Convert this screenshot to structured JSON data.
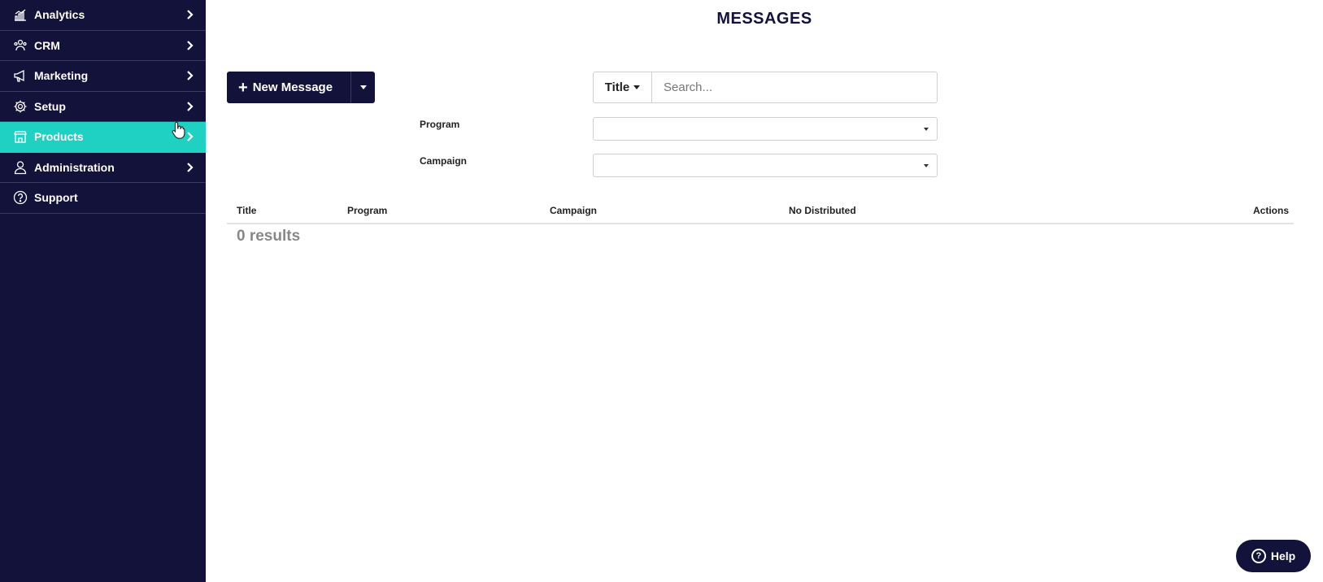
{
  "sidebar": {
    "items": [
      {
        "label": "Analytics",
        "icon": "analytics-icon",
        "has_chevron": true
      },
      {
        "label": "CRM",
        "icon": "crm-icon",
        "has_chevron": true
      },
      {
        "label": "Marketing",
        "icon": "megaphone-icon",
        "has_chevron": true
      },
      {
        "label": "Setup",
        "icon": "gear-icon",
        "has_chevron": true
      },
      {
        "label": "Products",
        "icon": "store-icon",
        "has_chevron": true,
        "active": true
      },
      {
        "label": "Administration",
        "icon": "user-icon",
        "has_chevron": true
      },
      {
        "label": "Support",
        "icon": "question-icon",
        "has_chevron": false
      }
    ]
  },
  "page": {
    "title": "MESSAGES"
  },
  "toolbar": {
    "new_button_label": "New Message"
  },
  "search": {
    "field_selector": "Title",
    "placeholder": "Search...",
    "value": ""
  },
  "filters": {
    "program_label": "Program",
    "program_value": "",
    "campaign_label": "Campaign",
    "campaign_value": ""
  },
  "table": {
    "columns": [
      "Title",
      "Program",
      "Campaign",
      "No Distributed",
      "Actions"
    ],
    "rows": [],
    "results_text": "0 results"
  },
  "help": {
    "label": "Help"
  },
  "colors": {
    "sidebar_bg": "#13123a",
    "active_item": "#1fd1c2",
    "primary_button": "#13123a"
  }
}
